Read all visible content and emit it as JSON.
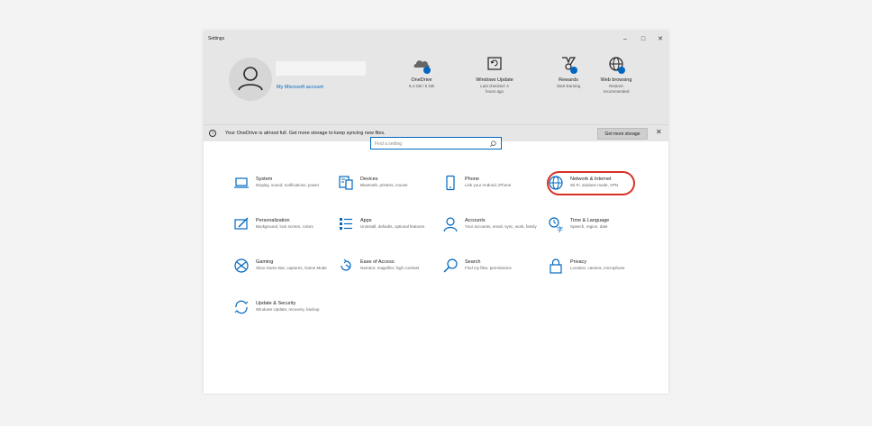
{
  "window": {
    "title": "Settings",
    "controls": {
      "minimize": "–",
      "maximize": "□",
      "close": "✕"
    }
  },
  "account": {
    "link_label": "My Microsoft account"
  },
  "header_items": [
    {
      "label": "OneDrive",
      "sub": [
        "6.4 GB / 5 GB"
      ],
      "icon": "onedrive-icon"
    },
    {
      "label": "Windows Update",
      "sub": [
        "Last checked: 4",
        "hours ago"
      ],
      "icon": "windows-update-icon"
    },
    {
      "label": "Rewards",
      "sub": [
        "Start Earning"
      ],
      "icon": "rewards-icon"
    },
    {
      "label": "Web browsing",
      "sub": [
        "Restore",
        "recommended"
      ],
      "icon": "web-browsing-icon"
    }
  ],
  "notice": {
    "message": "Your OneDrive is almost full. Get more storage to keep syncing new files.",
    "button_label": "Get more storage",
    "close": "✕"
  },
  "search": {
    "placeholder": "Find a setting"
  },
  "categories": [
    {
      "name": "System",
      "desc": "Display, sound, notifications, power",
      "icon": "laptop-icon"
    },
    {
      "name": "Devices",
      "desc": "Bluetooth, printers, mouse",
      "icon": "devices-icon"
    },
    {
      "name": "Phone",
      "desc": "Link your Android, iPhone",
      "icon": "phone-icon"
    },
    {
      "name": "Network & Internet",
      "desc": "Wi-Fi, airplane mode, VPN",
      "icon": "globe-icon"
    },
    {
      "name": "Personalization",
      "desc": "Background, lock screen, colors",
      "icon": "personalization-icon"
    },
    {
      "name": "Apps",
      "desc": "Uninstall, defaults, optional features",
      "icon": "apps-list-icon"
    },
    {
      "name": "Accounts",
      "desc": "Your accounts, email, sync, work, family",
      "icon": "person-icon"
    },
    {
      "name": "Time & Language",
      "desc": "Speech, region, date",
      "icon": "time-language-icon"
    },
    {
      "name": "Gaming",
      "desc": "Xbox Game Bar, captures, Game Mode",
      "icon": "xbox-icon"
    },
    {
      "name": "Ease of Access",
      "desc": "Narrator, magnifier, high contrast",
      "icon": "ease-of-access-icon"
    },
    {
      "name": "Search",
      "desc": "Find my files, permissions",
      "icon": "search-icon"
    },
    {
      "name": "Privacy",
      "desc": "Location, camera, microphone",
      "icon": "lock-icon"
    },
    {
      "name": "Update & Security",
      "desc": "Windows Update, recovery, backup",
      "icon": "update-sync-icon"
    }
  ],
  "colors": {
    "accent": "#0067c0",
    "highlight": "#d93025",
    "header_bg": "#e6e6e6"
  }
}
